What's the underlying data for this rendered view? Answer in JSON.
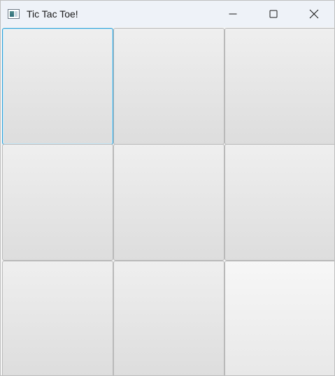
{
  "window": {
    "title": "Tic Tac Toe!",
    "app_icon": "java-app-icon",
    "controls": [
      "minimize-icon",
      "maximize-icon",
      "close-icon"
    ]
  },
  "board": {
    "rows": 3,
    "cols": 3,
    "cells": [
      "",
      "",
      "",
      "",
      "",
      "",
      "",
      "",
      ""
    ],
    "focused_cell": 0,
    "hovered_cell": 8
  },
  "colors": {
    "titlebar": "#eef2f8",
    "focus_border": "#2a9fd8",
    "cell_top": "#efefef",
    "cell_bottom": "#dddddd"
  }
}
